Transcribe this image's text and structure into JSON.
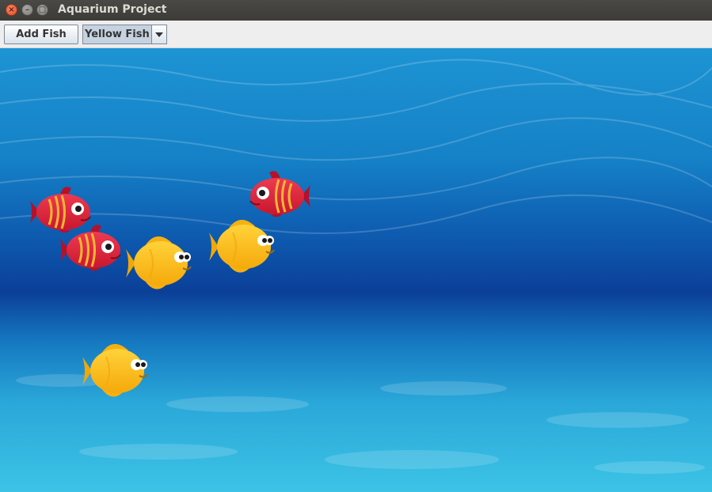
{
  "window": {
    "title": "Aquarium Project"
  },
  "toolbar": {
    "add_fish_label": "Add Fish",
    "fish_type_selected": "Yellow Fish"
  },
  "aquarium": {
    "fish": [
      {
        "type": "red"
      },
      {
        "type": "red"
      },
      {
        "type": "red"
      },
      {
        "type": "yellow"
      },
      {
        "type": "yellow"
      },
      {
        "type": "yellow"
      }
    ]
  },
  "colors": {
    "red_fish": "#e0263c",
    "yellow_fish": "#ffc31a",
    "water_top": "#1a8fd0",
    "water_deep": "#0b3f98",
    "water_floor": "#35bde0"
  }
}
